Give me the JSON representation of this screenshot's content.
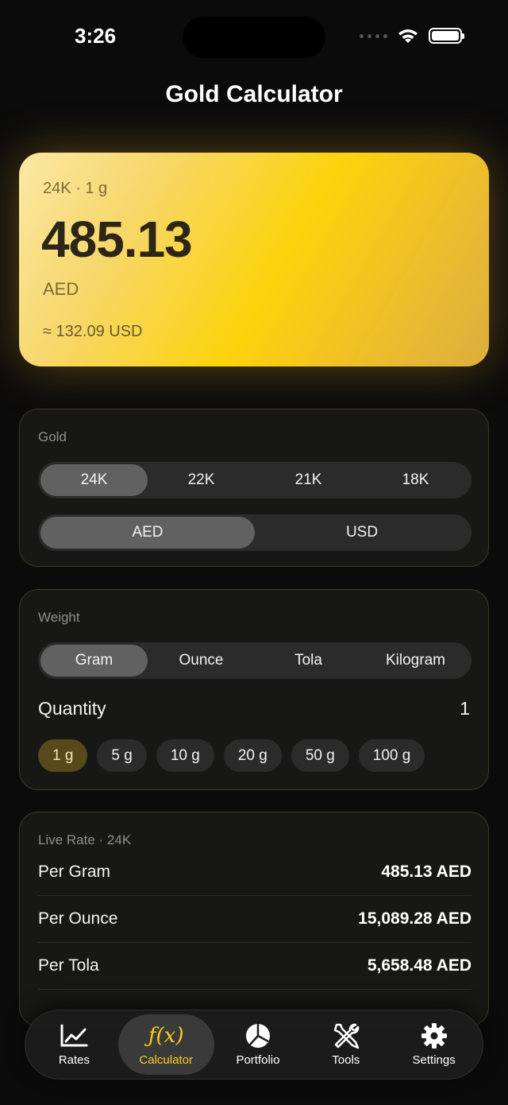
{
  "status": {
    "time": "3:26"
  },
  "title": "Gold Calculator",
  "hero": {
    "subtitle": "24K · 1 g",
    "value": "485.13",
    "currency": "AED",
    "converted": "≈ 132.09 USD"
  },
  "gold_card": {
    "label": "Gold",
    "karats": [
      "24K",
      "22K",
      "21K",
      "18K"
    ],
    "selected_karat": "24K",
    "currencies": [
      "AED",
      "USD"
    ],
    "selected_currency": "AED"
  },
  "weight_card": {
    "label": "Weight",
    "units": [
      "Gram",
      "Ounce",
      "Tola",
      "Kilogram"
    ],
    "selected_unit": "Gram",
    "quantity_label": "Quantity",
    "quantity_value": "1",
    "presets": [
      "1 g",
      "5 g",
      "10 g",
      "20 g",
      "50 g",
      "100 g"
    ],
    "selected_preset": "1 g"
  },
  "rate_card": {
    "label": "Live Rate · 24K",
    "rows": [
      {
        "name": "Per Gram",
        "value": "485.13 AED"
      },
      {
        "name": "Per Ounce",
        "value": "15,089.28 AED"
      },
      {
        "name": "Per Tola",
        "value": "5,658.48 AED"
      }
    ]
  },
  "tabbar": {
    "items": [
      {
        "label": "Rates",
        "icon": "chart-line-icon"
      },
      {
        "label": "Calculator",
        "icon": "function-icon"
      },
      {
        "label": "Portfolio",
        "icon": "pie-chart-icon"
      },
      {
        "label": "Tools",
        "icon": "tools-icon"
      },
      {
        "label": "Settings",
        "icon": "gear-icon"
      }
    ],
    "active": "Calculator",
    "active_color": "#f9cd1b"
  },
  "colors": {
    "accent": "#f9cd1b",
    "background": "#0b0b0b",
    "card": "#171715"
  }
}
